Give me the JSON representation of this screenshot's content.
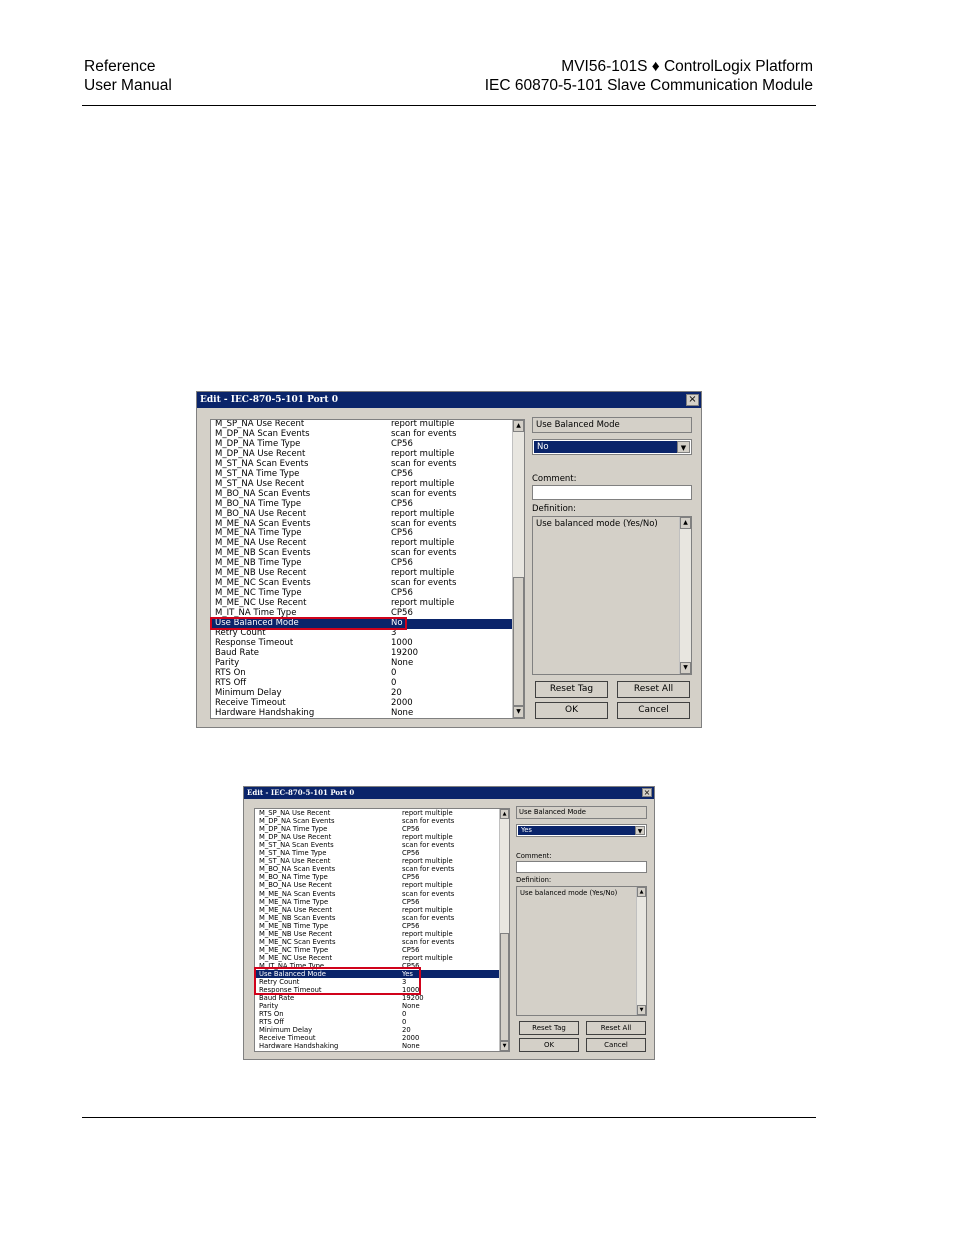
{
  "header": {
    "left_line1": "Reference",
    "left_line2": "User Manual",
    "right_line1": "MVI56-101S ♦ ControlLogix Platform",
    "right_line2": "IEC 60870-5-101 Slave Communication Module"
  },
  "dialog1": {
    "title": "Edit - IEC-870-5-101 Port 0",
    "close": "×",
    "rows": [
      [
        "M_SP_NA Use Recent",
        "report multiple"
      ],
      [
        "M_DP_NA Scan Events",
        "scan for events"
      ],
      [
        "M_DP_NA Time Type",
        "CP56"
      ],
      [
        "M_DP_NA Use Recent",
        "report multiple"
      ],
      [
        "M_ST_NA Scan Events",
        "scan for events"
      ],
      [
        "M_ST_NA Time Type",
        "CP56"
      ],
      [
        "M_ST_NA Use Recent",
        "report multiple"
      ],
      [
        "M_BO_NA Scan Events",
        "scan for events"
      ],
      [
        "M_BO_NA Time Type",
        "CP56"
      ],
      [
        "M_BO_NA Use Recent",
        "report multiple"
      ],
      [
        "M_ME_NA Scan Events",
        "scan for events"
      ],
      [
        "M_ME_NA Time Type",
        "CP56"
      ],
      [
        "M_ME_NA Use Recent",
        "report multiple"
      ],
      [
        "M_ME_NB Scan Events",
        "scan for events"
      ],
      [
        "M_ME_NB Time Type",
        "CP56"
      ],
      [
        "M_ME_NB Use Recent",
        "report multiple"
      ],
      [
        "M_ME_NC Scan Events",
        "scan for events"
      ],
      [
        "M_ME_NC Time Type",
        "CP56"
      ],
      [
        "M_ME_NC Use Recent",
        "report multiple"
      ],
      [
        "M_IT_NA Time Type",
        "CP56"
      ],
      [
        "Use Balanced Mode",
        "No"
      ],
      [
        "Retry Count",
        "3"
      ],
      [
        "Response Timeout",
        "1000"
      ],
      [
        "Baud Rate",
        "19200"
      ],
      [
        "Parity",
        "None"
      ],
      [
        "RTS On",
        "0"
      ],
      [
        "RTS Off",
        "0"
      ],
      [
        "Minimum Delay",
        "20"
      ],
      [
        "Receive Timeout",
        "2000"
      ],
      [
        "Hardware Handshaking",
        "None"
      ]
    ],
    "selected_index": 20,
    "param_name": "Use Balanced Mode",
    "combo_value": "No",
    "comment_label": "Comment:",
    "comment_value": "",
    "definition_label": "Definition:",
    "definition_text": "Use balanced mode (Yes/No)",
    "buttons": {
      "reset_tag": "Reset Tag",
      "reset_all": "Reset All",
      "ok": "OK",
      "cancel": "Cancel"
    },
    "scroll_up": "▲",
    "scroll_down": "▼",
    "combo_arrow": "▼"
  },
  "dialog2": {
    "title": "Edit - IEC-870-5-101 Port 0",
    "close": "×",
    "rows": [
      [
        "M_SP_NA Use Recent",
        "report multiple"
      ],
      [
        "M_DP_NA Scan Events",
        "scan for events"
      ],
      [
        "M_DP_NA Time Type",
        "CP56"
      ],
      [
        "M_DP_NA Use Recent",
        "report multiple"
      ],
      [
        "M_ST_NA Scan Events",
        "scan for events"
      ],
      [
        "M_ST_NA Time Type",
        "CP56"
      ],
      [
        "M_ST_NA Use Recent",
        "report multiple"
      ],
      [
        "M_BO_NA Scan Events",
        "scan for events"
      ],
      [
        "M_BO_NA Time Type",
        "CP56"
      ],
      [
        "M_BO_NA Use Recent",
        "report multiple"
      ],
      [
        "M_ME_NA Scan Events",
        "scan for events"
      ],
      [
        "M_ME_NA Time Type",
        "CP56"
      ],
      [
        "M_ME_NA Use Recent",
        "report multiple"
      ],
      [
        "M_ME_NB Scan Events",
        "scan for events"
      ],
      [
        "M_ME_NB Time Type",
        "CP56"
      ],
      [
        "M_ME_NB Use Recent",
        "report multiple"
      ],
      [
        "M_ME_NC Scan Events",
        "scan for events"
      ],
      [
        "M_ME_NC Time Type",
        "CP56"
      ],
      [
        "M_ME_NC Use Recent",
        "report multiple"
      ],
      [
        "M_IT_NA Time Type",
        "CP56"
      ],
      [
        "Use Balanced Mode",
        "Yes"
      ],
      [
        "Retry Count",
        "3"
      ],
      [
        "Response Timeout",
        "1000"
      ],
      [
        "Baud Rate",
        "19200"
      ],
      [
        "Parity",
        "None"
      ],
      [
        "RTS On",
        "0"
      ],
      [
        "RTS Off",
        "0"
      ],
      [
        "Minimum Delay",
        "20"
      ],
      [
        "Receive Timeout",
        "2000"
      ],
      [
        "Hardware Handshaking",
        "None"
      ]
    ],
    "selected_index": 20,
    "param_name": "Use Balanced Mode",
    "combo_value": "Yes",
    "comment_label": "Comment:",
    "comment_value": "",
    "definition_label": "Definition:",
    "definition_text": "Use balanced mode (Yes/No)",
    "buttons": {
      "reset_tag": "Reset Tag",
      "reset_all": "Reset All",
      "ok": "OK",
      "cancel": "Cancel"
    },
    "scroll_up": "▲",
    "scroll_down": "▼",
    "combo_arrow": "▼"
  },
  "colors": {
    "selection": "#0a246a",
    "highlight": "#d0021b",
    "dialog_bg": "#d4d0c8"
  }
}
